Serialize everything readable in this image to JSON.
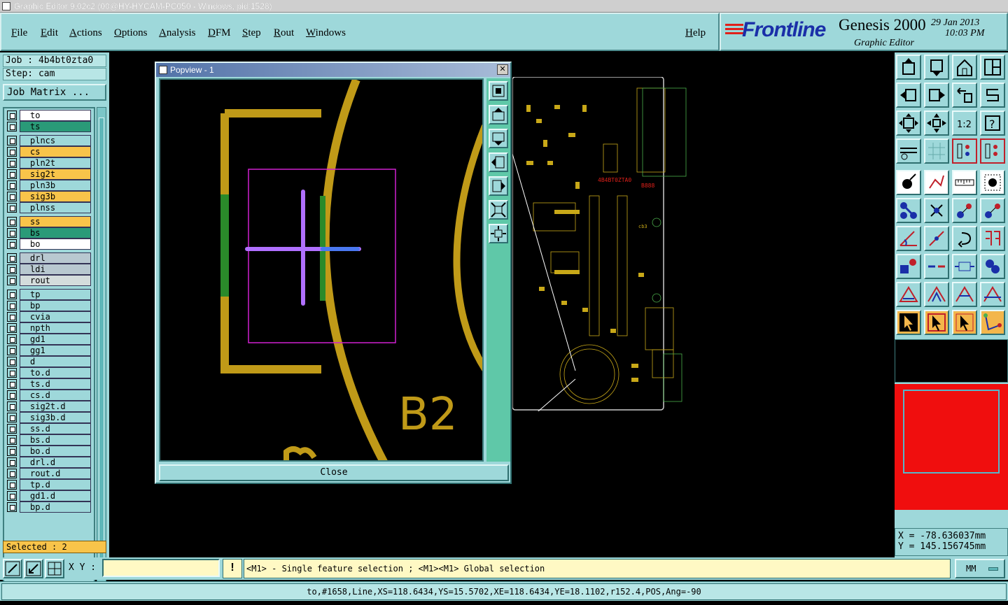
{
  "window": {
    "title": "Graphic Editor 9.02c2 (00@HY-HYCAM-PC050 - Windows, pid:1528)"
  },
  "menu": {
    "file": "File",
    "edit": "Edit",
    "actions": "Actions",
    "options": "Options",
    "analysis": "Analysis",
    "dfm": "DFM",
    "step": "Step",
    "rout": "Rout",
    "windows": "Windows",
    "help": "Help"
  },
  "brand": {
    "logo": "Frontline",
    "product": "Genesis 2000",
    "subtitle": "Graphic Editor",
    "date": "29 Jan 2013",
    "time": "10:03 PM",
    "logo_color": "#1a2fa8",
    "accent": "#e0201a"
  },
  "job": {
    "job_label": "Job : 4b4bt0zta0",
    "step_label": "Step: cam",
    "matrix_button": "Job Matrix ..."
  },
  "layers": [
    {
      "name": "to",
      "color": "#ffffff"
    },
    {
      "name": "ts",
      "color": "#2a9a78"
    },
    {
      "name": "plncs",
      "color": "#9ed8da"
    },
    {
      "name": "cs",
      "color": "#f8c44a"
    },
    {
      "name": "pln2t",
      "color": "#9ed8da"
    },
    {
      "name": "sig2t",
      "color": "#f8c44a"
    },
    {
      "name": "pln3b",
      "color": "#9ed8da"
    },
    {
      "name": "sig3b",
      "color": "#f8c44a"
    },
    {
      "name": "plnss",
      "color": "#9ed8da"
    },
    {
      "name": "ss",
      "color": "#f8c44a"
    },
    {
      "name": "bs",
      "color": "#2a9a78"
    },
    {
      "name": "bo",
      "color": "#ffffff"
    },
    {
      "name": "drl",
      "color": "#b8c8d0"
    },
    {
      "name": "ldi",
      "color": "#b8c8d0"
    },
    {
      "name": "rout",
      "color": "#d4dcdc"
    },
    {
      "name": "tp",
      "color": "#9ed8da"
    },
    {
      "name": "bp",
      "color": "#9ed8da"
    },
    {
      "name": "cvia",
      "color": "#9ed8da"
    },
    {
      "name": "npth",
      "color": "#9ed8da"
    },
    {
      "name": "gd1",
      "color": "#9ed8da"
    },
    {
      "name": "gg1",
      "color": "#9ed8da"
    },
    {
      "name": "d",
      "color": "#9ed8da"
    },
    {
      "name": "to.d",
      "color": "#9ed8da"
    },
    {
      "name": "ts.d",
      "color": "#9ed8da"
    },
    {
      "name": "cs.d",
      "color": "#9ed8da"
    },
    {
      "name": "sig2t.d",
      "color": "#9ed8da"
    },
    {
      "name": "sig3b.d",
      "color": "#9ed8da"
    },
    {
      "name": "ss.d",
      "color": "#9ed8da"
    },
    {
      "name": "bs.d",
      "color": "#9ed8da"
    },
    {
      "name": "bo.d",
      "color": "#9ed8da"
    },
    {
      "name": "drl.d",
      "color": "#9ed8da"
    },
    {
      "name": "rout.d",
      "color": "#9ed8da"
    },
    {
      "name": "tp.d",
      "color": "#9ed8da"
    },
    {
      "name": "gd1.d",
      "color": "#9ed8da"
    },
    {
      "name": "bp.d",
      "color": "#9ed8da"
    }
  ],
  "selection": {
    "label": "Selected : 2"
  },
  "popview": {
    "title": "Popview - 1",
    "close": "Close",
    "canvas_text": "B2"
  },
  "pcb": {
    "job_tag": "4B4BT0ZTA0",
    "date_tag": "B888",
    "cb_tag": "cb3"
  },
  "coords": {
    "x": "X = -78.636037mm",
    "y": "Y = 145.156745mm"
  },
  "command": {
    "xy_label": "X Y :",
    "xy_value": "",
    "warn": "!",
    "hint": "<M1> - Single feature selection ; <M1><M1> Global selection",
    "units": "MM"
  },
  "status": {
    "text": "to,#1658,Line,XS=118.6434,YS=15.5702,XE=118.6434,YE=18.1102,r152.4,POS,Ang=-90"
  }
}
